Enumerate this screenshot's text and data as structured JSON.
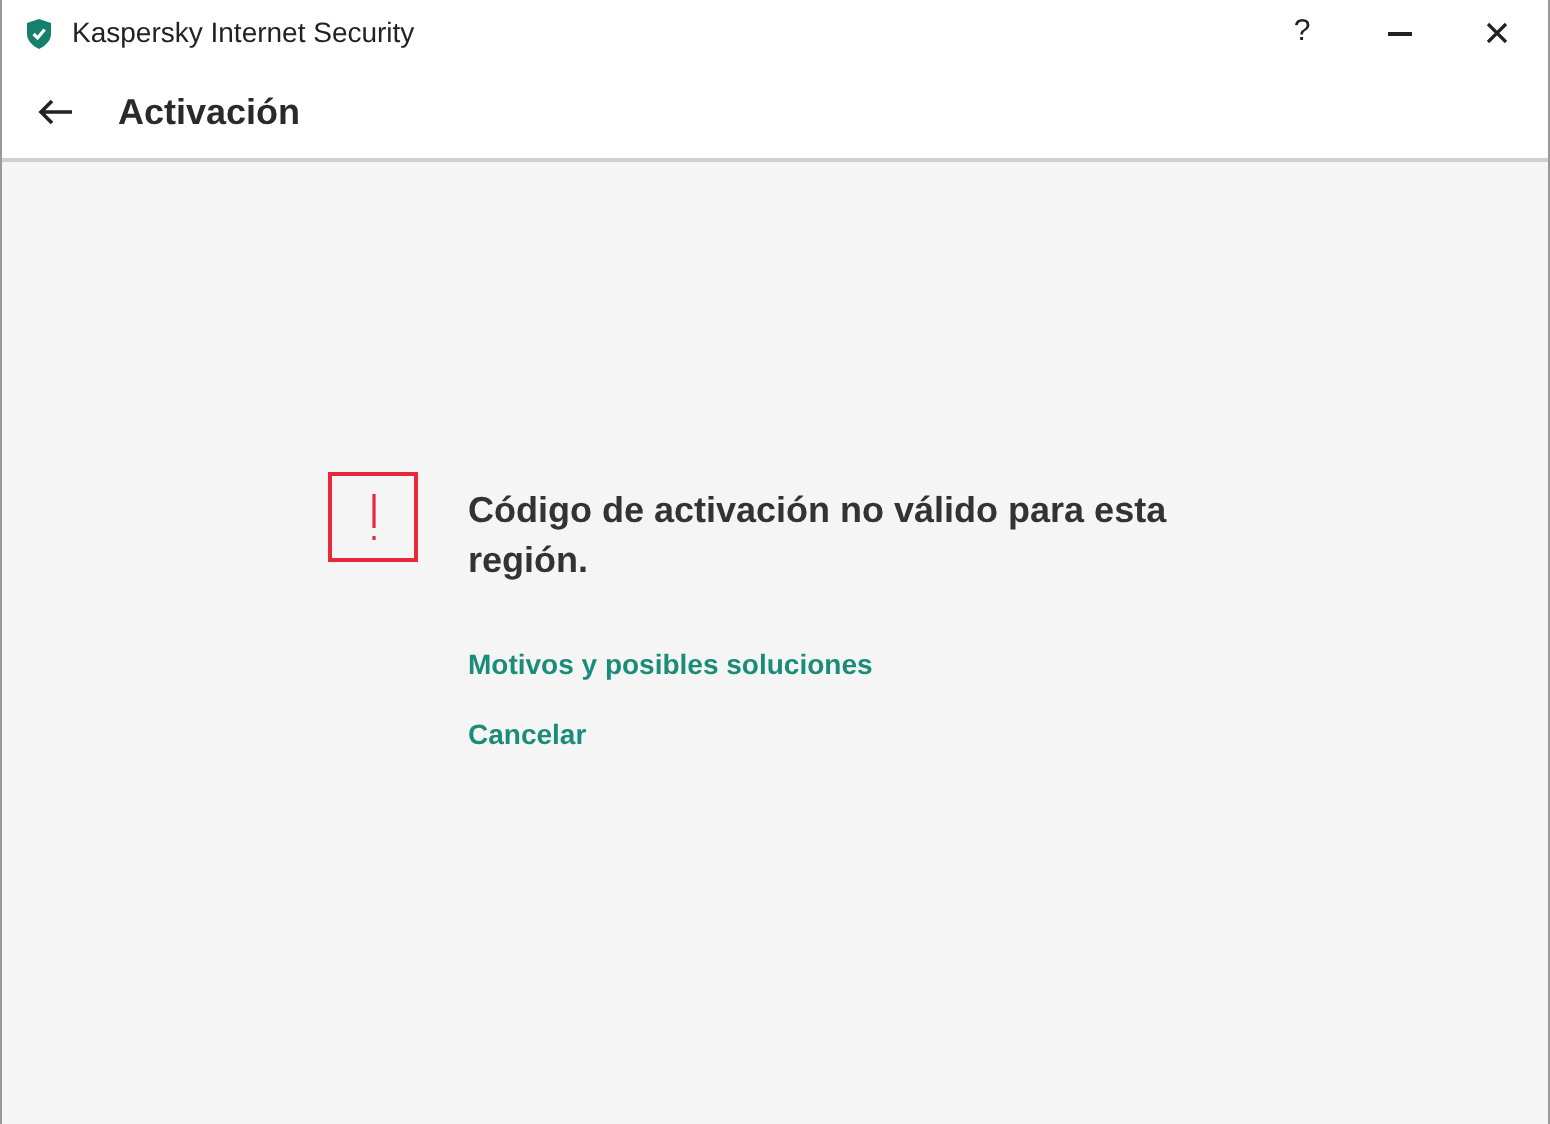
{
  "window": {
    "title": "Kaspersky Internet Security",
    "help": "?"
  },
  "header": {
    "title": "Activación"
  },
  "message": {
    "text": "Código de activación no válido para esta región."
  },
  "links": [
    {
      "label": "Motivos y posibles soluciones"
    },
    {
      "label": "Cancelar"
    }
  ]
}
